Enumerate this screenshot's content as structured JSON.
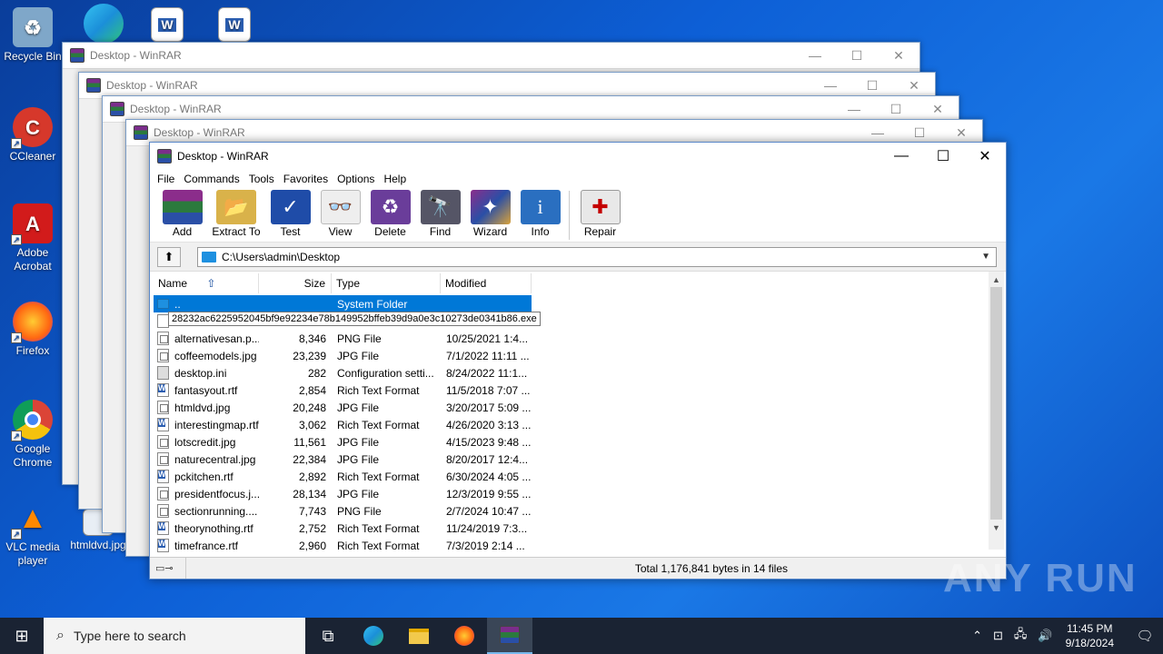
{
  "desktop": {
    "icons": [
      {
        "label": "Recycle Bin",
        "icon": "recycle-bin-icon"
      },
      {
        "label": "CCleaner",
        "icon": "ccleaner-icon"
      },
      {
        "label": "Adobe Acrobat",
        "icon": "adobe-acrobat-icon"
      },
      {
        "label": "Firefox",
        "icon": "firefox-icon"
      },
      {
        "label": "Google Chrome",
        "icon": "chrome-icon"
      },
      {
        "label": "VLC media player",
        "icon": "vlc-icon"
      },
      {
        "label": "htmldvd.jpg",
        "icon": "image-file-icon"
      }
    ]
  },
  "background_windows": [
    {
      "title": "Desktop - WinRAR"
    },
    {
      "title": "Desktop - WinRAR"
    },
    {
      "title": "Desktop - WinRAR"
    },
    {
      "title": "Desktop - WinRAR"
    }
  ],
  "window": {
    "title": "Desktop - WinRAR",
    "menu": [
      "File",
      "Commands",
      "Tools",
      "Favorites",
      "Options",
      "Help"
    ],
    "toolbar": [
      {
        "label": "Add",
        "icon": "add-archive-icon"
      },
      {
        "label": "Extract To",
        "icon": "extract-icon"
      },
      {
        "label": "Test",
        "icon": "test-icon"
      },
      {
        "label": "View",
        "icon": "view-icon"
      },
      {
        "label": "Delete",
        "icon": "delete-icon"
      },
      {
        "label": "Find",
        "icon": "find-icon"
      },
      {
        "label": "Wizard",
        "icon": "wizard-icon"
      },
      {
        "label": "Info",
        "icon": "info-icon"
      },
      {
        "label": "Repair",
        "icon": "repair-icon"
      }
    ],
    "path": "C:\\Users\\admin\\Desktop",
    "columns": {
      "name": "Name",
      "size": "Size",
      "type": "Type",
      "modified": "Modified"
    },
    "tooltip": "28232ac6225952045bf9e92234e78b149952bffeb39d9a0e3c10273de0341b86.exe",
    "files": [
      {
        "name": "..",
        "size": "",
        "type": "System Folder",
        "modified": "",
        "kind": "folder"
      },
      {
        "name": "",
        "size": "",
        "type": "",
        "modified": "",
        "kind": "exe"
      },
      {
        "name": "alternativesan.p...",
        "size": "8,346",
        "type": "PNG File",
        "modified": "10/25/2021 1:4...",
        "kind": "img"
      },
      {
        "name": "coffeemodels.jpg",
        "size": "23,239",
        "type": "JPG File",
        "modified": "7/1/2022 11:11 ...",
        "kind": "img"
      },
      {
        "name": "desktop.ini",
        "size": "282",
        "type": "Configuration setti...",
        "modified": "8/24/2022 11:1...",
        "kind": "sys"
      },
      {
        "name": "fantasyout.rtf",
        "size": "2,854",
        "type": "Rich Text Format",
        "modified": "11/5/2018 7:07 ...",
        "kind": "rtf"
      },
      {
        "name": "htmldvd.jpg",
        "size": "20,248",
        "type": "JPG File",
        "modified": "3/20/2017 5:09 ...",
        "kind": "img"
      },
      {
        "name": "interestingmap.rtf",
        "size": "3,062",
        "type": "Rich Text Format",
        "modified": "4/26/2020 3:13 ...",
        "kind": "rtf"
      },
      {
        "name": "lotscredit.jpg",
        "size": "11,561",
        "type": "JPG File",
        "modified": "4/15/2023 9:48 ...",
        "kind": "img"
      },
      {
        "name": "naturecentral.jpg",
        "size": "22,384",
        "type": "JPG File",
        "modified": "8/20/2017 12:4...",
        "kind": "img"
      },
      {
        "name": "pckitchen.rtf",
        "size": "2,892",
        "type": "Rich Text Format",
        "modified": "6/30/2024 4:05 ...",
        "kind": "rtf"
      },
      {
        "name": "presidentfocus.j...",
        "size": "28,134",
        "type": "JPG File",
        "modified": "12/3/2019 9:55 ...",
        "kind": "img"
      },
      {
        "name": "sectionrunning....",
        "size": "7,743",
        "type": "PNG File",
        "modified": "2/7/2024 10:47 ...",
        "kind": "img"
      },
      {
        "name": "theorynothing.rtf",
        "size": "2,752",
        "type": "Rich Text Format",
        "modified": "11/24/2019 7:3...",
        "kind": "rtf"
      },
      {
        "name": "timefrance.rtf",
        "size": "2,960",
        "type": "Rich Text Format",
        "modified": "7/3/2019 2:14 ...",
        "kind": "rtf"
      }
    ],
    "status": "Total 1,176,841 bytes in 14 files"
  },
  "watermark": "ANY RUN",
  "taskbar": {
    "search_placeholder": "Type here to search",
    "time": "11:45 PM",
    "date": "9/18/2024"
  }
}
